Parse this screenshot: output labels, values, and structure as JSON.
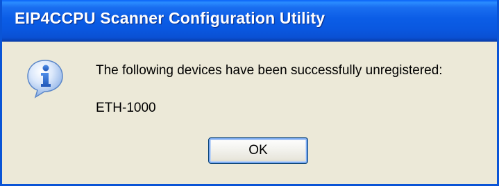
{
  "window": {
    "title": "EIP4CCPU Scanner Configuration Utility"
  },
  "icon": {
    "name": "info-icon",
    "glyph": "i"
  },
  "message": {
    "text": "The following devices have been successfully unregistered:",
    "devices": [
      "ETH-1000"
    ]
  },
  "buttons": {
    "ok_label": "OK"
  },
  "colors": {
    "title_bar": "#0a58e0",
    "dialog_background": "#ece9d8",
    "icon_fill": "#3b76d6"
  }
}
